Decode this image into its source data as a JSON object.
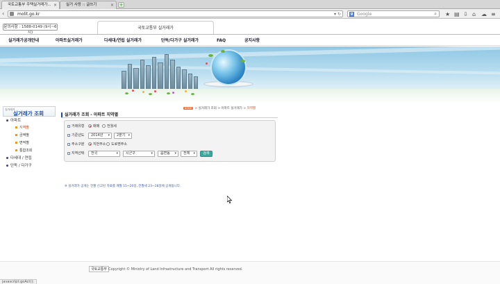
{
  "browser": {
    "tabs": [
      {
        "label": "국토교통부 주택실거래가...",
        "active": true
      },
      {
        "label": "실거 사랑 :: 글쓰기",
        "active": false
      }
    ],
    "new_tab_label": "+",
    "url": "molit.go.kr",
    "search_placeholder": "Google",
    "status_text": "javascript:goAct();"
  },
  "header": {
    "inquiry": "문의사항 : 1588-0149 (9시~6시)",
    "site_title": "국토교통부 실거래가"
  },
  "gnb": {
    "items": [
      "실거래가공개안내",
      "아파트실거래가",
      "다세대/연립 실거래가",
      "단독/다가구 실거래가",
      "FAQ",
      "공지사항"
    ]
  },
  "lnb": {
    "head_small": "실거래가",
    "head_title": "실거래가 조회",
    "items": [
      {
        "label": "아파트"
      },
      {
        "label": "다세대 / 연립"
      },
      {
        "label": "단독 / 다가구"
      }
    ],
    "subitems": [
      {
        "label": "지역별",
        "active": true
      },
      {
        "label": "금액별",
        "active": false
      },
      {
        "label": "면적별",
        "active": false
      },
      {
        "label": "통합조회",
        "active": false
      }
    ]
  },
  "content": {
    "breadcrumb_home": "HOME",
    "breadcrumb_path": "> 실거래가 조회 > 아파트 실거래가 > ",
    "breadcrumb_current": "지역별",
    "title": "실거래가 조회 - 아파트 지역별",
    "form": {
      "row1_label": "거래유형",
      "row1_options": [
        {
          "label": "매매",
          "checked": true
        },
        {
          "label": "전월세",
          "checked": false
        }
      ],
      "row2_label": "기준년도",
      "row2_year": "2014년",
      "row2_quarter": "2분기",
      "row3_label": "주소구분",
      "row3_options": [
        {
          "label": "지번주소",
          "checked": true
        },
        {
          "label": "도로명주소",
          "checked": false
        }
      ],
      "row4_label": "지역선택",
      "row4_selects": [
        "전국",
        "시군구",
        "읍면동",
        "전체"
      ],
      "search_button": "검색"
    },
    "notice": "※ 실거래가 공개는 전월 신고된 자료를 매월 15~20일, 전월세 23~28일에 공개됩니다."
  },
  "footer": {
    "logo": "국토교통부",
    "copyright": "Copyright © Ministry of Land Infrastructure and Transport All rights reserved."
  }
}
